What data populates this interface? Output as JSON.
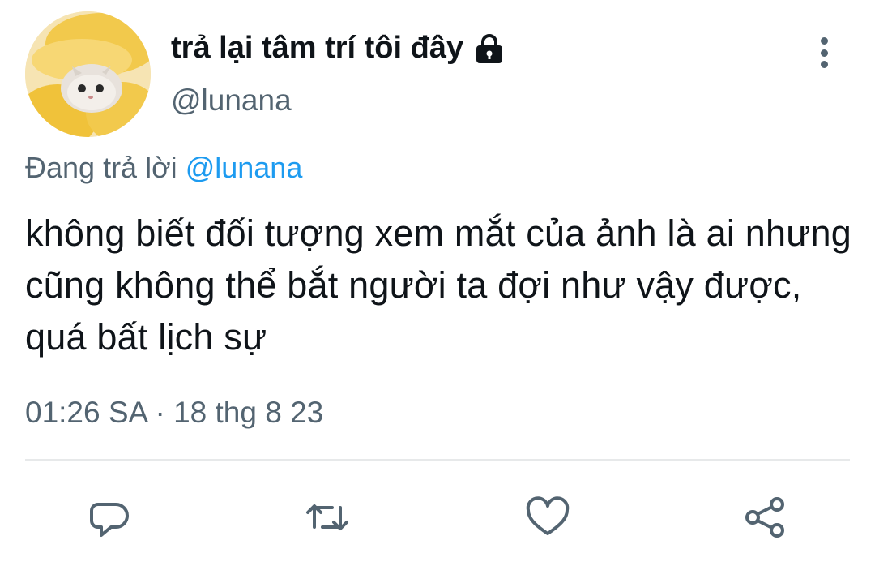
{
  "profile": {
    "display_name": "trả lại tâm trí tôi đây",
    "handle": "@lunana",
    "avatar_icon": "cat-avatar-icon",
    "protected_icon": "lock-icon"
  },
  "reply": {
    "prefix": "Đang trả lời ",
    "mention": "@lunana"
  },
  "tweet": {
    "text": "không biết đối tượng xem mắt của ảnh là ai nhưng cũng không thể bắt người ta đợi như vậy được, quá bất lịch sự",
    "timestamp": "01:26 SA · 18 thg 8 23"
  },
  "actions": [
    {
      "name": "reply",
      "icon": "reply-icon"
    },
    {
      "name": "retweet",
      "icon": "retweet-icon"
    },
    {
      "name": "like",
      "icon": "heart-icon"
    },
    {
      "name": "share",
      "icon": "share-icon"
    }
  ],
  "colors": {
    "text_primary": "#0f1419",
    "text_secondary": "#536471",
    "accent": "#1d9bf0",
    "divider": "#e7e9ea"
  }
}
